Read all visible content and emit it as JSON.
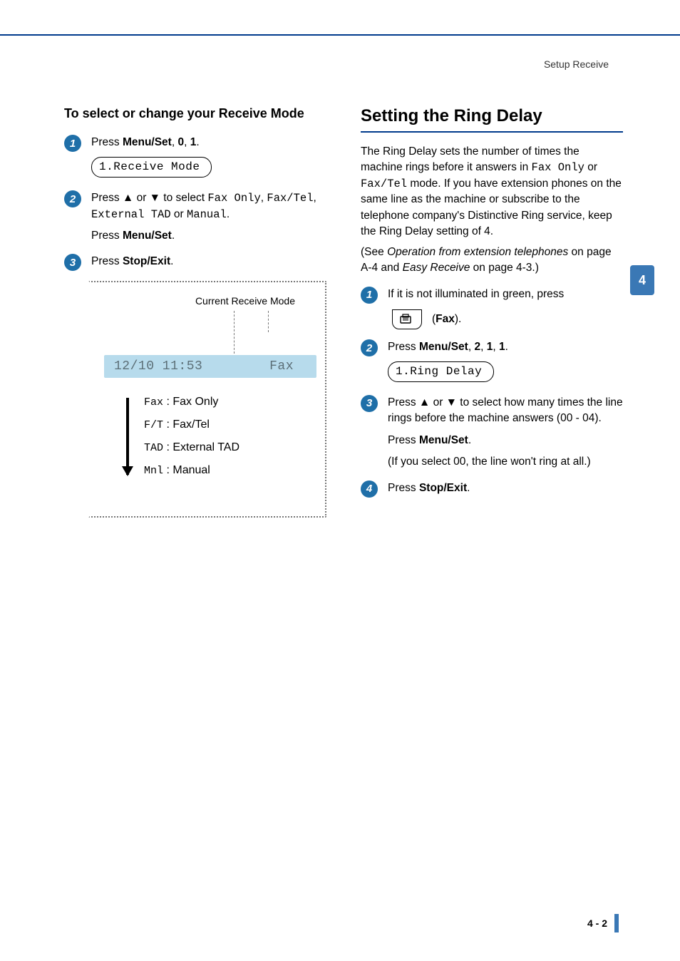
{
  "header": {
    "section": "Setup Receive"
  },
  "chapter_tab": "4",
  "footer": {
    "page": "4 - 2"
  },
  "left": {
    "heading": "To select or change your Receive Mode",
    "steps": [
      {
        "num": "1",
        "pre": "Press ",
        "bold": "Menu/Set",
        "tail": ", ",
        "bold2": "0",
        "tail2": ", ",
        "bold3": "1",
        "tail3": ".",
        "lcd": "1.Receive Mode"
      },
      {
        "num": "2",
        "pre": "Press ▲ or ▼ to select ",
        "mono1": "Fax Only",
        "mid1": ", ",
        "mono2": "Fax/Tel",
        "mid2": ", ",
        "mono3": "External TAD",
        "mid3": " or ",
        "mono4": "Manual",
        "tail": ".",
        "sub_pre": "Press ",
        "sub_bold": "Menu/Set",
        "sub_tail": "."
      },
      {
        "num": "3",
        "pre": "Press ",
        "bold": "Stop/Exit",
        "tail": "."
      }
    ],
    "diagram": {
      "label": "Current Receive Mode",
      "lcd_date": "12/10 11:53",
      "lcd_mode": "Fax",
      "items": [
        {
          "code": "Fax",
          "name": ": Fax Only"
        },
        {
          "code": "F/T",
          "name": ": Fax/Tel"
        },
        {
          "code": "TAD",
          "name": ": External TAD"
        },
        {
          "code": "Mnl",
          "name": ": Manual"
        }
      ]
    }
  },
  "right": {
    "heading": "Setting the Ring Delay",
    "intro": {
      "t1": "The Ring Delay sets the number of times the machine rings before it answers in ",
      "m1": "Fax Only",
      "t2": " or ",
      "m2": "Fax/Tel",
      "t3": " mode. If you have extension phones on the same line as the machine or subscribe to the telephone company's Distinctive Ring service, keep the Ring Delay setting of 4.",
      "see_pre": "(See ",
      "see_i1": "Operation from extension telephones",
      "see_mid": " on page A-4 and ",
      "see_i2": "Easy Receive",
      "see_tail": " on page 4-3.)"
    },
    "steps": [
      {
        "num": "1",
        "text": "If it is not illuminated in green, press",
        "fax_label": "Fax"
      },
      {
        "num": "2",
        "pre": "Press ",
        "bold": "Menu/Set",
        "tail": ", ",
        "bold2": "2",
        "tail2": ", ",
        "bold3": "1",
        "tail3": ", ",
        "bold4": "1",
        "tail4": ".",
        "lcd": "1.Ring Delay"
      },
      {
        "num": "3",
        "text": "Press ▲ or ▼ to select how many times the line rings before the machine answers (00 - 04).",
        "sub_pre": "Press ",
        "sub_bold": "Menu/Set",
        "sub_tail": ".",
        "note": "(If you select 00, the line won't ring at all.)"
      },
      {
        "num": "4",
        "pre": "Press ",
        "bold": "Stop/Exit",
        "tail": "."
      }
    ]
  }
}
